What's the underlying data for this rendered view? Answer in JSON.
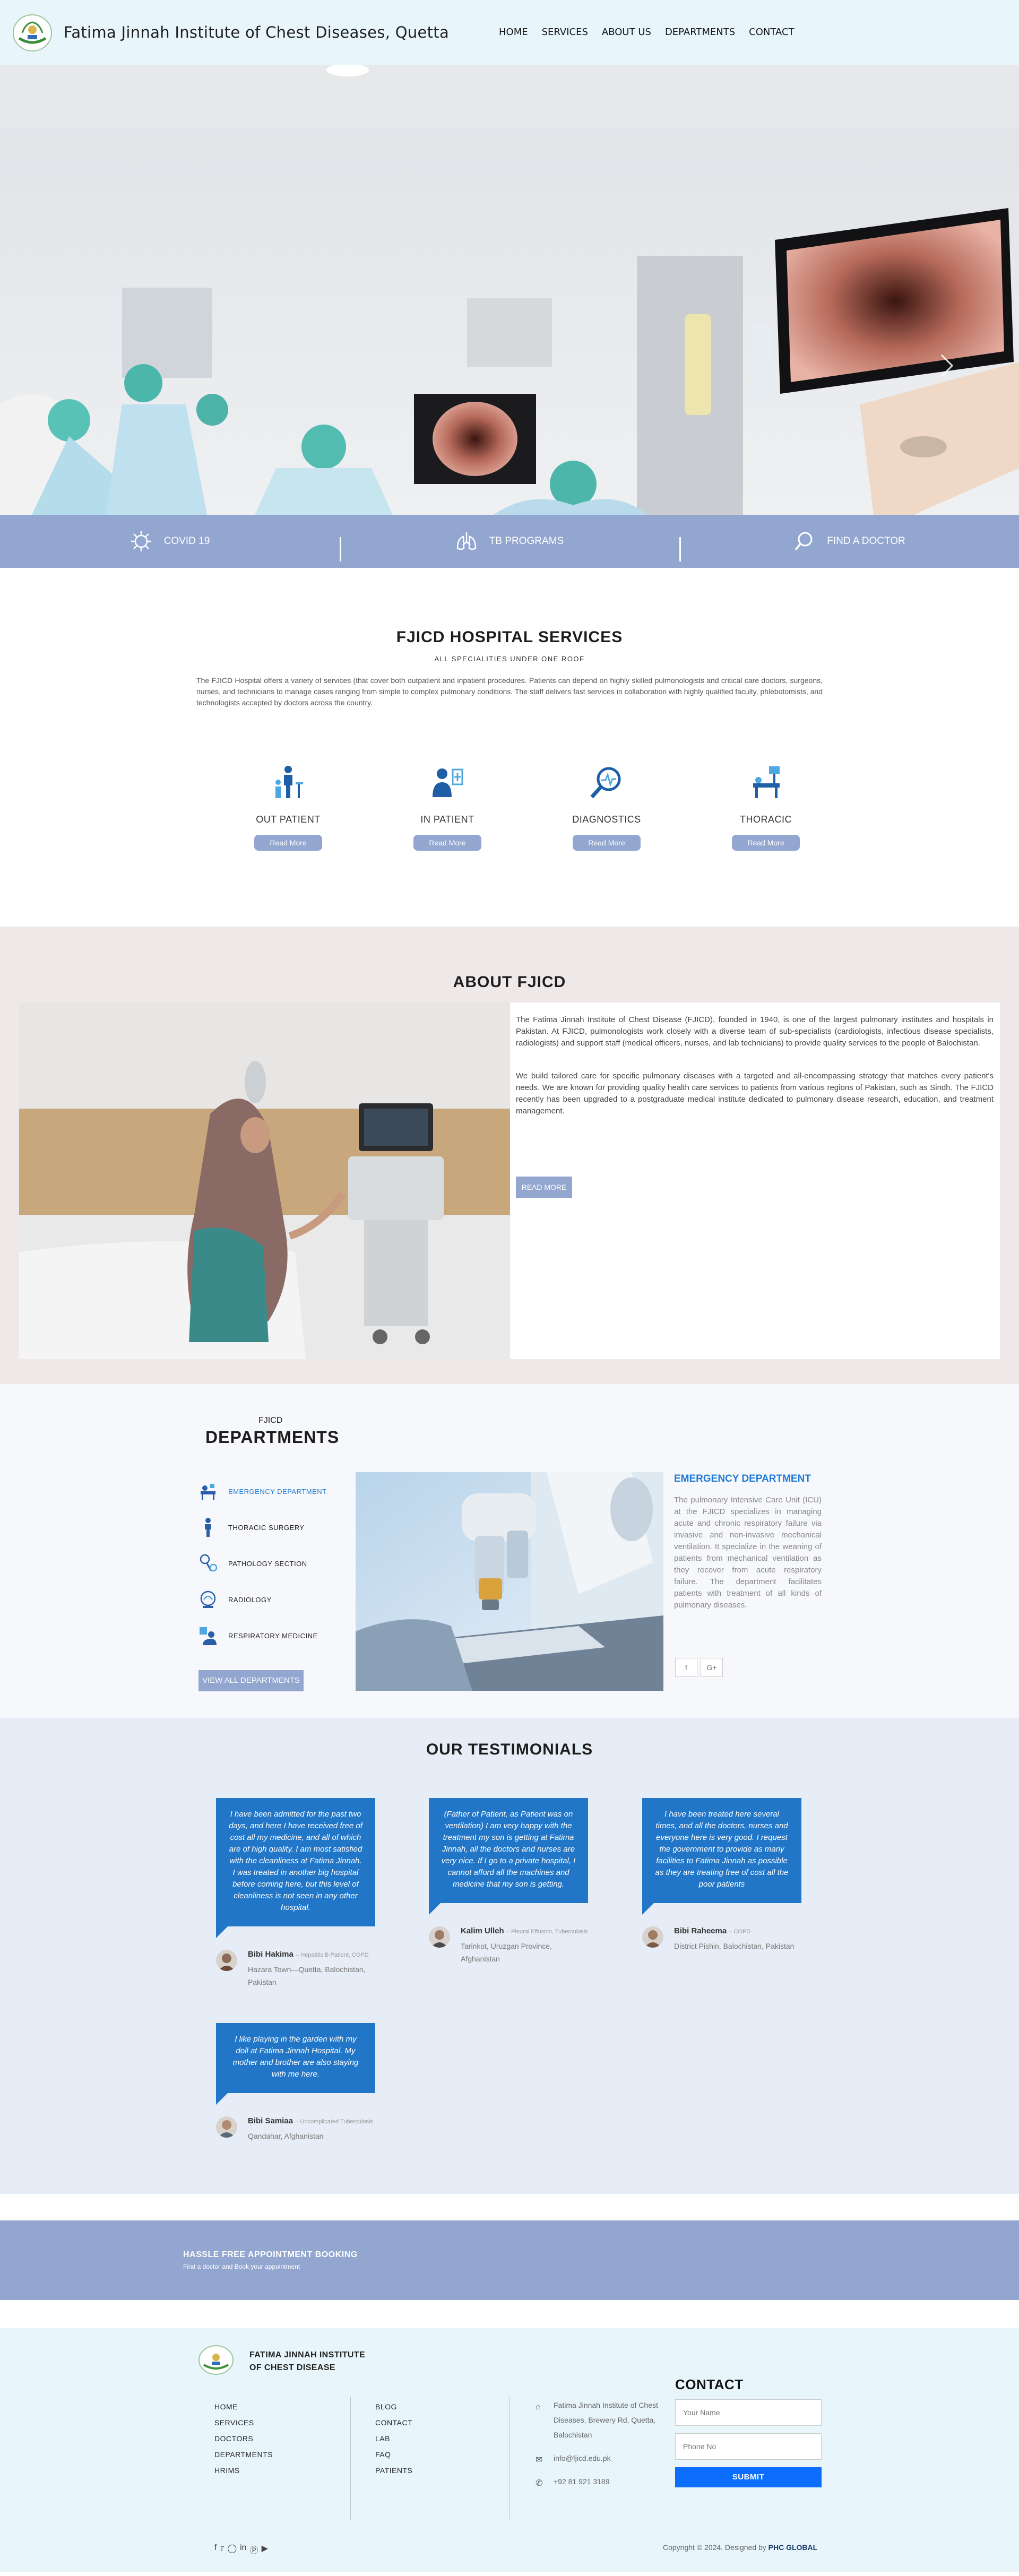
{
  "header": {
    "title": "Fatima Jinnah Institute of Chest Diseases, Quetta",
    "nav": [
      "HOME",
      "SERVICES",
      "ABOUT US",
      "DEPARTMENTS",
      "CONTACT"
    ]
  },
  "quick_links": [
    {
      "label": "COVID 19",
      "icon": "virus-icon"
    },
    {
      "label": "TB PROGRAMS",
      "icon": "lungs-icon"
    },
    {
      "label": "FIND A DOCTOR",
      "icon": "search-icon"
    }
  ],
  "services": {
    "title": "FJICD HOSPITAL SERVICES",
    "subtitle": "ALL SPECIALITIES UNDER ONE ROOF",
    "description": "The FJICD Hospital offers a variety of services (that cover both outpatient and inpatient procedures. Patients can depend on highly skilled pulmonologists and critical care doctors, surgeons, nurses, and technicians to manage cases ranging from simple to complex pulmonary conditions. The staff delivers fast services in collaboration with highly qualified faculty, phlebotomists, and technologists accepted by doctors across the country.",
    "items": [
      {
        "label": "OUT PATIENT",
        "button": "Read More",
        "icon": "outpatient-icon"
      },
      {
        "label": "IN PATIENT",
        "button": "Read More",
        "icon": "inpatient-icon"
      },
      {
        "label": "DIAGNOSTICS",
        "button": "Read More",
        "icon": "diagnostics-icon"
      },
      {
        "label": "THORACIC",
        "button": "Read More",
        "icon": "thoracic-icon"
      }
    ]
  },
  "about": {
    "title": "ABOUT FJICD",
    "para1": "The Fatima Jinnah Institute of Chest Disease (FJICD), founded in 1940, is one of the largest pulmonary institutes and hospitals in Pakistan. At FJICD, pulmonologists work closely with a diverse team of sub-specialists (cardiologists, infectious disease specialists, radiologists) and support staff (medical officers, nurses, and lab technicians) to provide quality services to the people of Balochistan.",
    "para2": "We build tailored care for specific pulmonary diseases with a targeted and all-encompassing strategy that matches every patient's needs. We are known for providing quality health care services to patients from various regions of Pakistan, such as Sindh. The FJICD recently has been upgraded to a postgraduate medical institute dedicated to pulmonary disease research, education, and treatment management.",
    "button": "READ MORE"
  },
  "departments": {
    "kicker": "FJICD",
    "title": "DEPARTMENTS",
    "items": [
      {
        "label": "EMERGENCY DEPARTMENT",
        "icon": "emergency-icon"
      },
      {
        "label": "THORACIC SURGERY",
        "icon": "surgery-icon"
      },
      {
        "label": "PATHOLOGY SECTION",
        "icon": "pathology-icon"
      },
      {
        "label": "RADIOLOGY",
        "icon": "radiology-icon"
      },
      {
        "label": "RESPIRATORY MEDICINE",
        "icon": "respiratory-icon"
      }
    ],
    "view_all": "VIEW ALL DEPARTMENTS",
    "detail_title": "EMERGENCY DEPARTMENT",
    "detail_text": "The pulmonary Intensive Care Unit (ICU) at the FJICD specializes in managing acute and chronic respiratory failure via invasive and non-invasive mechanical ventilation. It specialize in the weaning of patients from mechanical ventilation as they recover from acute respiratory failure. The department facilitates patients with treatment of all kinds of pulmonary diseases.",
    "social": [
      "f",
      "G+"
    ]
  },
  "testimonials": {
    "title": "OUR TESTIMONIALS",
    "items": [
      {
        "quote": "I have been admitted for the past two days, and here I have received free of cost all my medicine, and all of which are of high quality. I am most satisfied with the cleanliness at Fatima Jinnah. I was treated in another big hospital before coming here, but this level of cleanliness is not seen in any other hospital.",
        "name": "Bibi Hakima",
        "role": "Hepatitis B Patient, COPD",
        "location": "Hazara Town—Quetta, Balochistan, Pakistan"
      },
      {
        "quote": "(Father of Patient, as Patient was on ventilation) I am very happy with the treatment my son is getting at Fatima Jinnah, all the doctors and nurses are very nice. If I go to a private hospital, I cannot afford all the machines and medicine that my son is getting.",
        "name": "Kalim Ulleh",
        "role": "Pleural Effusion, Tuberculosis",
        "location": "Tarinkot, Uruzgan Province, Afghanistan"
      },
      {
        "quote": "I have been treated here several times, and all the doctors, nurses and everyone here is very good. I request the government to provide as many facilities to Fatima Jinnah as possible as they are treating free of cost all the poor patients",
        "name": "Bibi Raheema",
        "role": "COPD",
        "location": "District Pishin, Balochistan, Pakistan"
      },
      {
        "quote": "I like playing in the garden with my doll at Fatima Jinnah Hospital. My mother and brother are also staying with me here.",
        "name": "Bibi Samiaa",
        "role": "Uncomplicated Tuberculosis",
        "location": "Qandahar, Afghanistan"
      }
    ]
  },
  "banner": {
    "title": "HASSLE FREE APPOINTMENT BOOKING",
    "subtitle": "Find a doctor and Book your appointment"
  },
  "footer": {
    "name_line1": "FATIMA JINNAH INSTITUTE",
    "name_line2": "OF CHEST DISEASE",
    "links1": [
      "HOME",
      "SERVICES",
      "DOCTORS",
      "DEPARTMENTS",
      "HRIMS"
    ],
    "links2": [
      "BLOG",
      "CONTACT",
      "LAB",
      "FAQ",
      "PATIENTS"
    ],
    "address": "Fatima Jinnah Institute of Chest Diseases, Brewery Rd, Quetta, Balochistan",
    "email": "info@fjicd.edu.pk",
    "phone": "+92 81 921 3189",
    "contact_title": "CONTACT",
    "name_placeholder": "Your Name",
    "phone_placeholder": "Phone No",
    "submit": "SUBMIT",
    "social_icons": [
      "facebook-icon",
      "twitter-icon",
      "instagram-icon",
      "linkedin-icon",
      "pinterest-icon",
      "youtube-icon"
    ],
    "copyright": "Copyright © 2024. Designed by",
    "designer": "PHC GLOBAL"
  },
  "colors": {
    "accent": "#92a6d0",
    "header_bg": "#e8f6fc",
    "testimonial_blue": "#2276c8",
    "link_blue": "#1f7bd6",
    "submit_blue": "#0d6efd"
  }
}
